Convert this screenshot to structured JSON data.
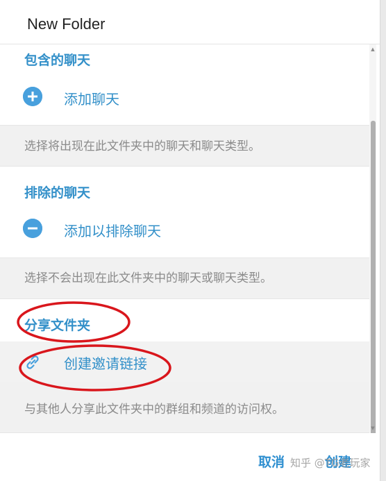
{
  "dialog": {
    "title": "New Folder"
  },
  "included": {
    "section_title": "包含的聊天",
    "add_icon": "plus-icon",
    "add_label": "添加聊天",
    "hint": "选择将出现在此文件夹中的聊天和聊天类型。"
  },
  "excluded": {
    "section_title": "排除的聊天",
    "add_icon": "minus-icon",
    "add_label": "添加以排除聊天",
    "hint": "选择不会出现在此文件夹中的聊天或聊天类型。"
  },
  "share": {
    "section_title": "分享文件夹",
    "link_icon": "link-icon",
    "link_label": "创建邀请链接",
    "hint": "与其他人分享此文件夹中的群组和频道的访问权。"
  },
  "footer": {
    "cancel_label": "取消",
    "create_label": "创建"
  },
  "watermark": "知乎 @TG老玩家",
  "colors": {
    "accent": "#3390c9",
    "icon_fill": "#48a0dd",
    "annotation": "#d9161c",
    "hint_bg": "#f1f1f1"
  }
}
